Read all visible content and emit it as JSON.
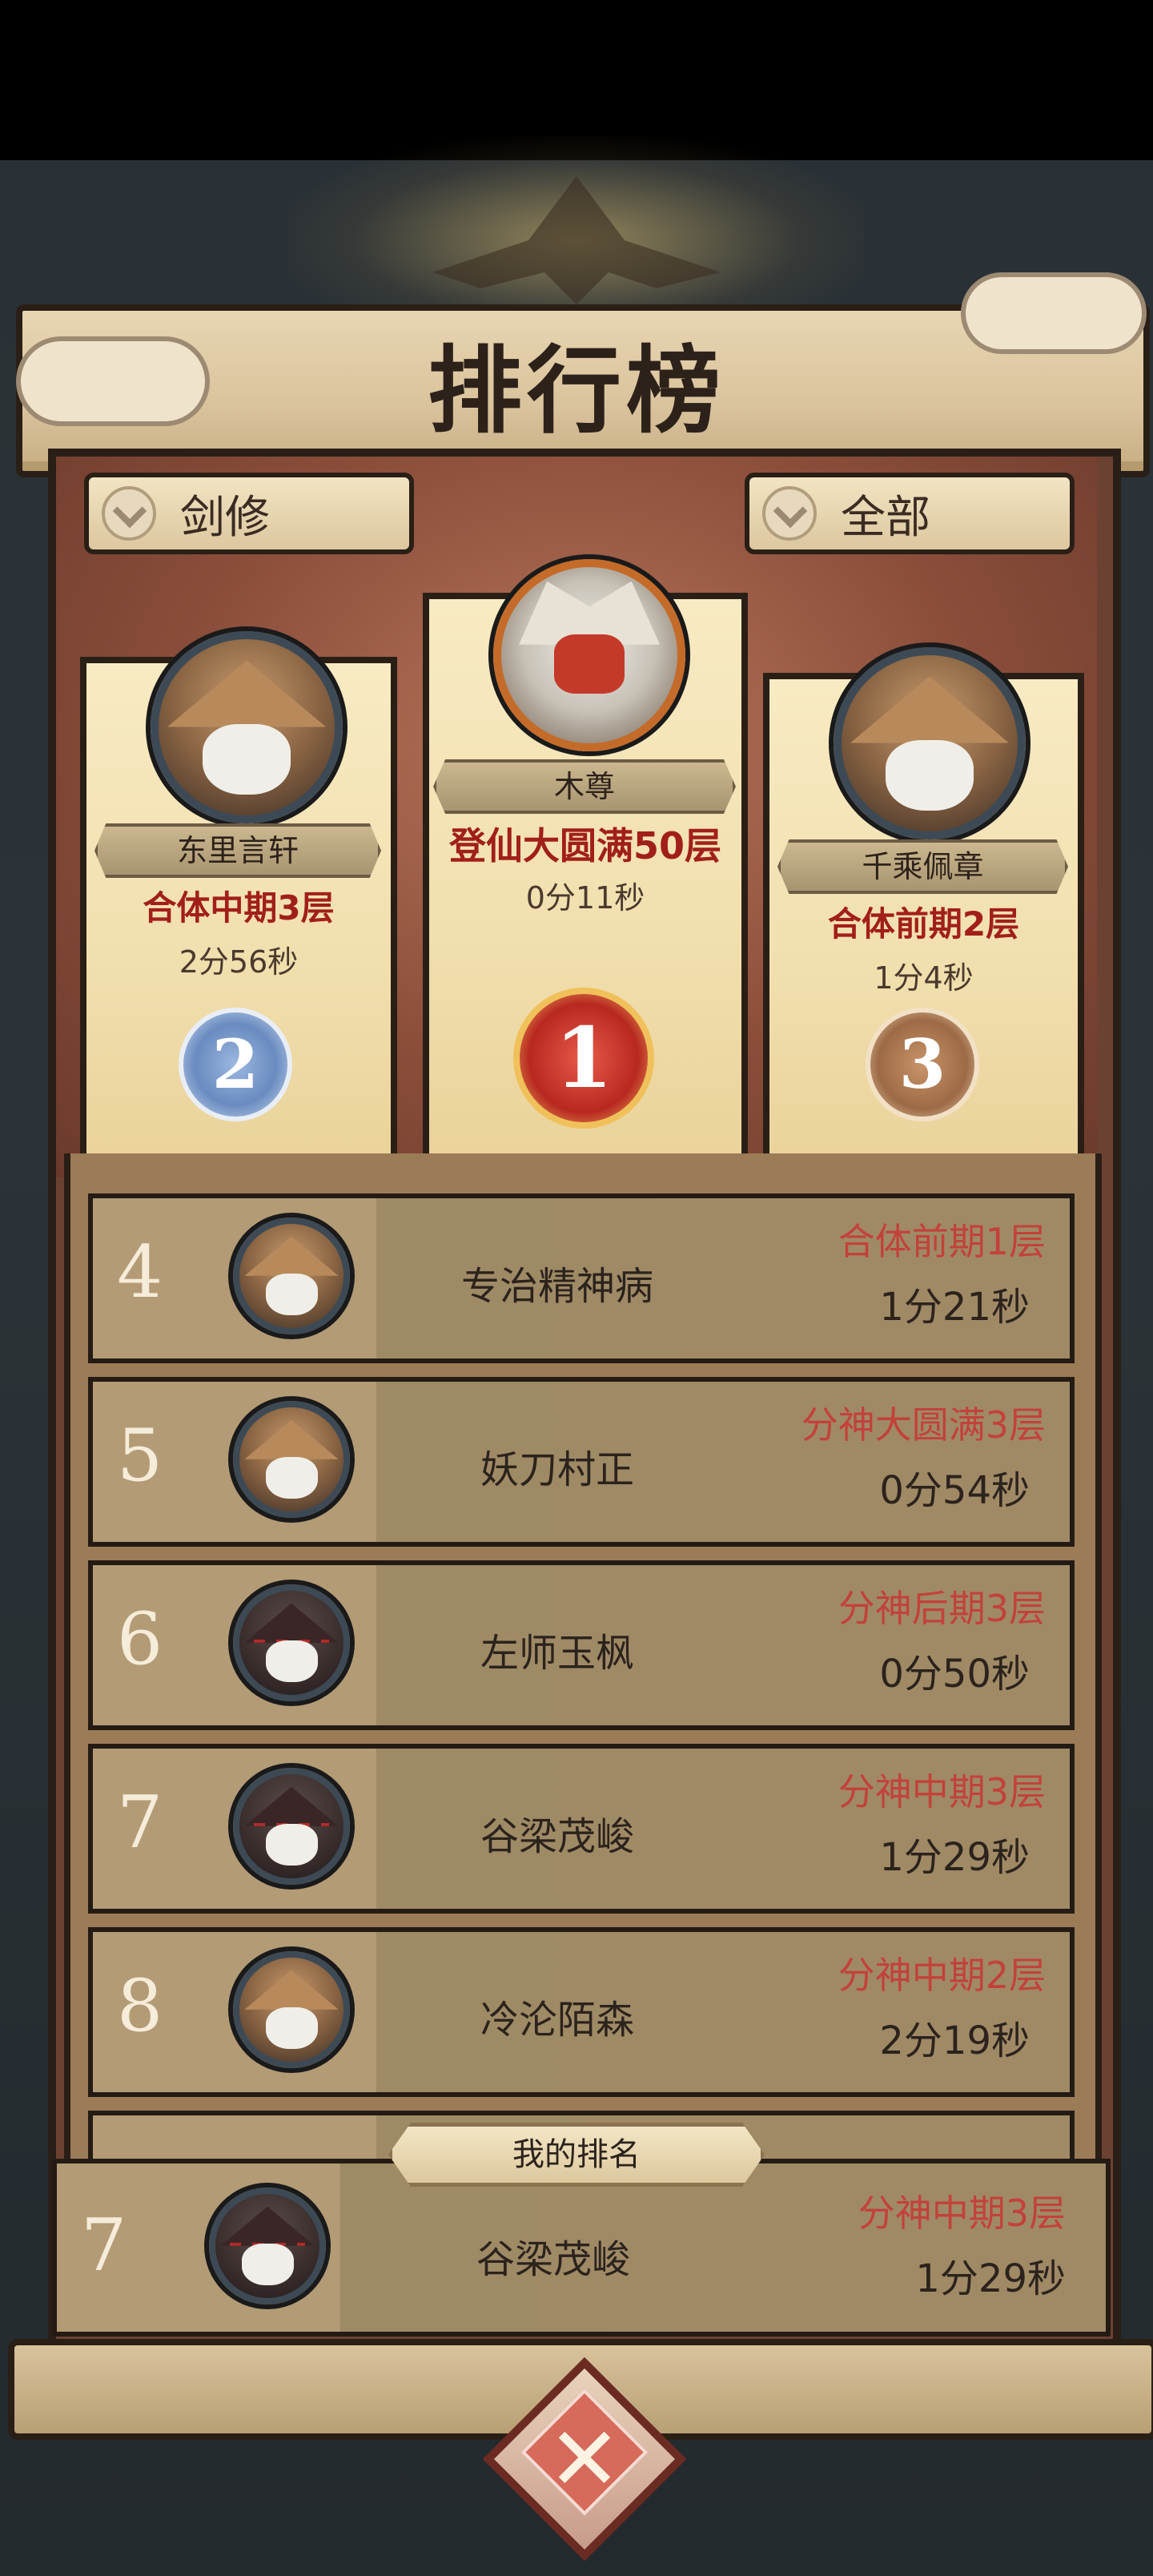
{
  "header": {
    "title": "排行榜"
  },
  "filters": {
    "sect": "剑修",
    "scope": "全部"
  },
  "podium": [
    {
      "rank_label": "1",
      "name": "木尊",
      "realm": "登仙大圆满50层",
      "time": "0分11秒"
    },
    {
      "rank_label": "2",
      "name": "东里言轩",
      "realm": "合体中期3层",
      "time": "2分56秒"
    },
    {
      "rank_label": "3",
      "name": "千乘佩章",
      "realm": "合体前期2层",
      "time": "1分4秒"
    }
  ],
  "list": [
    {
      "rank": "4",
      "name": "专治精神病",
      "realm": "合体前期1层",
      "time": "1分21秒",
      "avatar": "straw-hat"
    },
    {
      "rank": "5",
      "name": "妖刀村正",
      "realm": "分神大圆满3层",
      "time": "0分54秒",
      "avatar": "straw-hat"
    },
    {
      "rank": "6",
      "name": "左师玉枫",
      "realm": "分神后期3层",
      "time": "0分50秒",
      "avatar": "dark-hat"
    },
    {
      "rank": "7",
      "name": "谷梁茂峻",
      "realm": "分神中期3层",
      "time": "1分29秒",
      "avatar": "dark-hat"
    },
    {
      "rank": "8",
      "name": "冷沦陌森",
      "realm": "分神中期2层",
      "time": "2分19秒",
      "avatar": "straw-hat"
    }
  ],
  "my_rank": {
    "label": "我的排名",
    "rank": "7",
    "name": "谷梁茂峻",
    "realm": "分神中期3层",
    "time": "1分29秒"
  },
  "colors": {
    "realm_red": "#a11f1a",
    "row_realm": "#c2423a",
    "frame": "#2a1f16"
  },
  "icons": {
    "close": "close-icon",
    "dropdown": "chevron-down-icon"
  }
}
